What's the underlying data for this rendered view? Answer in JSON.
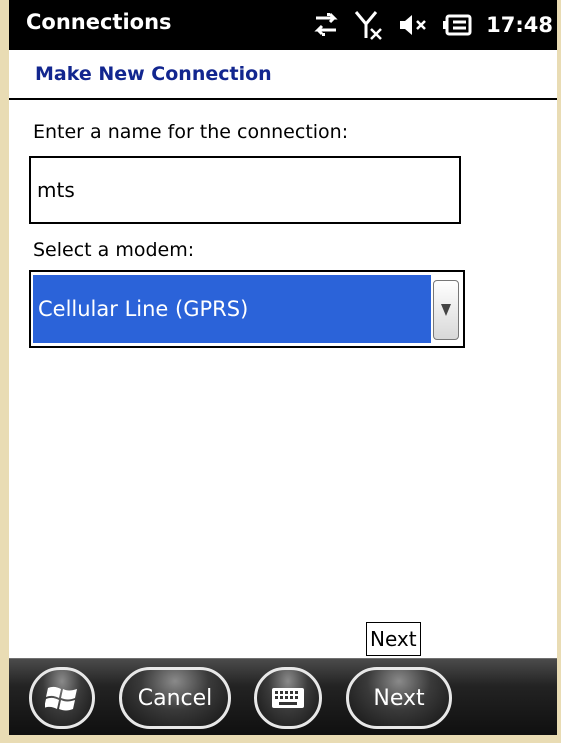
{
  "statusbar": {
    "title": "Connections",
    "time": "17:48",
    "icons": [
      "data-sync-icon",
      "no-signal-icon",
      "volume-muted-icon",
      "battery-charging-icon"
    ]
  },
  "page": {
    "title": "Make New Connection"
  },
  "form": {
    "name_label": "Enter a name for the connection:",
    "name_value": "mts",
    "modem_label": "Select a modem:",
    "modem_value": "Cellular Line (GPRS)"
  },
  "tooltip": {
    "text": "Next"
  },
  "bottombar": {
    "start_icon": "windows-start-icon",
    "cancel_label": "Cancel",
    "keyboard_icon": "keyboard-icon",
    "next_label": "Next"
  },
  "colors": {
    "title_blue": "#12268f",
    "selection_blue": "#2b63d9",
    "bezel": "#e9dcb4"
  }
}
